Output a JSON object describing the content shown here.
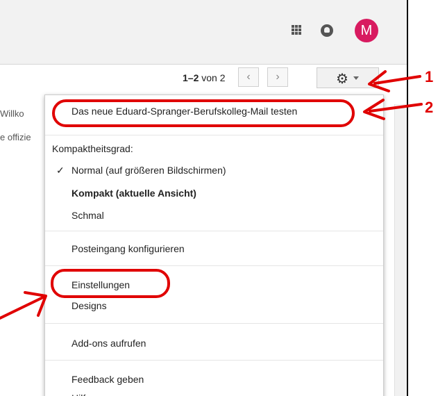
{
  "header": {
    "avatar_letter": "M",
    "brand_color": "#d81b60",
    "icons": [
      "apps-grid-icon",
      "notifications-icon",
      "account-avatar"
    ]
  },
  "toolbar": {
    "range": "1–2",
    "of_word": "von",
    "total": "2",
    "prev_label": "‹",
    "next_label": "›",
    "settings_icon": "gear-icon"
  },
  "list": {
    "rows": [
      "Willko",
      "e offizie"
    ]
  },
  "settings_menu": {
    "try_new_label": "Das neue Eduard-Spranger-Berufskolleg-Mail testen",
    "density_heading": "Kompaktheitsgrad:",
    "density_options": [
      {
        "label": "Normal (auf größeren Bildschirmen)",
        "checked": true
      },
      {
        "label": "Kompakt (aktuelle Ansicht)",
        "bold": true
      },
      {
        "label": "Schmal"
      }
    ],
    "configure_inbox": "Posteingang konfigurieren",
    "settings": "Einstellungen",
    "themes": "Designs",
    "addons": "Add-ons aufrufen",
    "feedback": "Feedback geben",
    "help": "Hilfe"
  },
  "annotations": {
    "num_1": "1",
    "num_2": "2",
    "accent_color": "#e00000"
  }
}
